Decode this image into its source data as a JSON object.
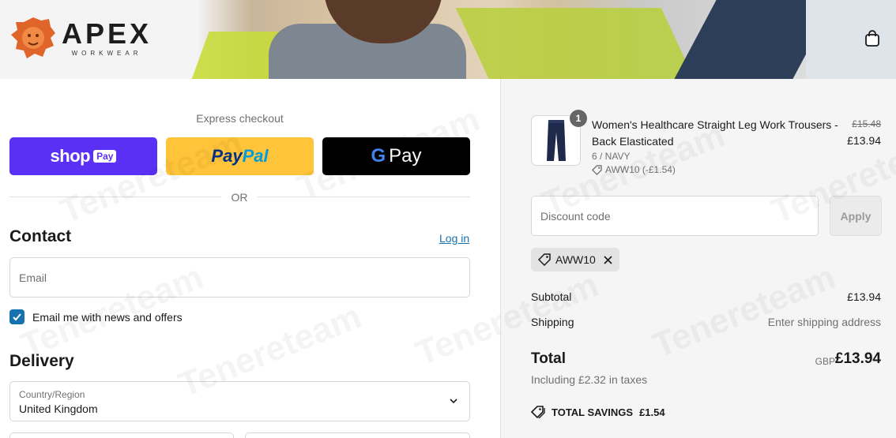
{
  "header": {
    "brand": "APEX",
    "brand_sub": "WORKWEAR",
    "bag_icon": "shopping-bag-icon"
  },
  "express": {
    "label": "Express checkout",
    "shop_word": "shop",
    "shop_pay": "Pay",
    "paypal_a": "Pay",
    "paypal_b": "Pal",
    "gpay_g": "G",
    "gpay_word": "Pay",
    "or": "OR"
  },
  "contact": {
    "title": "Contact",
    "login": "Log in",
    "email_placeholder": "Email",
    "newsletter_label": "Email me with news and offers",
    "newsletter_checked": true
  },
  "delivery": {
    "title": "Delivery",
    "country_label": "Country/Region",
    "country_value": "United Kingdom"
  },
  "summary": {
    "item": {
      "quantity": "1",
      "name": "Women's Healthcare Straight Leg Work Trousers - Back Elasticated",
      "variant": "6 / NAVY",
      "discount": "AWW10 (-£1.54)",
      "price_old": "£15.48",
      "price_new": "£13.94"
    },
    "discount_placeholder": "Discount code",
    "apply_label": "Apply",
    "applied_code": "AWW10",
    "subtotal_label": "Subtotal",
    "subtotal_value": "£13.94",
    "shipping_label": "Shipping",
    "shipping_value": "Enter shipping address",
    "total_label": "Total",
    "currency": "GBP",
    "total_value": "£13.94",
    "taxes": "Including £2.32 in taxes",
    "savings_label": "TOTAL SAVINGS",
    "savings_value": "£1.54"
  },
  "colors": {
    "shop_pay": "#5a31f4",
    "paypal": "#ffc439",
    "link": "#1773b0"
  }
}
